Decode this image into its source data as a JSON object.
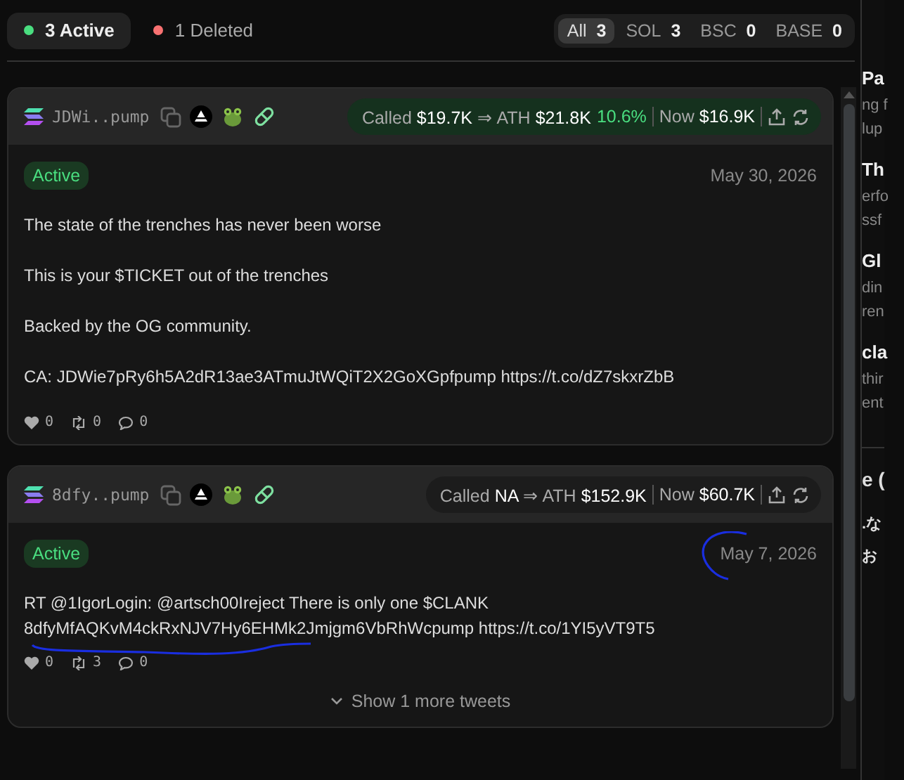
{
  "tabs": [
    {
      "label": "3 Active",
      "color": "#4ade80",
      "selected": true
    },
    {
      "label": "1 Deleted",
      "color": "#f87171",
      "selected": false
    }
  ],
  "chains": [
    {
      "label": "All",
      "count": "3",
      "selected": true
    },
    {
      "label": "SOL",
      "count": "3",
      "selected": false
    },
    {
      "label": "BSC",
      "count": "0",
      "selected": false
    },
    {
      "label": "BASE",
      "count": "0",
      "selected": false
    }
  ],
  "cards": [
    {
      "token": "JDWi..pump",
      "positive": true,
      "called_label": "Called",
      "called": "$19.7K",
      "arrow": "⇒",
      "ath_label": "ATH",
      "ath": "$21.8K",
      "gain": "10.6%",
      "now_label": "Now",
      "now": "$16.9K",
      "status": "Active",
      "date": "May 30, 2026",
      "annotated": false,
      "paragraphs": [
        "The state of the trenches has never been worse",
        "This is your $TICKET out of the trenches",
        "Backed by the OG community.",
        "CA: JDWie7pRy6h5A2dR13ae3ATmuJtWQiT2X2GoXGpfpump https://t.co/dZ7skxrZbB"
      ],
      "likes": "0",
      "retweets": "0",
      "replies": "0"
    },
    {
      "token": "8dfy..pump",
      "positive": false,
      "called_label": "Called",
      "called": "NA",
      "arrow": "⇒",
      "ath_label": "ATH",
      "ath": "$152.9K",
      "now_label": "Now",
      "now": "$60.7K",
      "status": "Active",
      "date": "May 7, 2026",
      "annotated": true,
      "paragraphs": [
        "RT @1IgorLogin: @artsch00Ireject There is only one $CLANK 8dfyMfAQKvM4ckRxNJV7Hy6EHMk2Jmjgm6VbRhWcpump https://t.co/1YI5yVT9T5"
      ],
      "likes": "0",
      "retweets": "3",
      "replies": "0",
      "more": "Show 1 more tweets"
    }
  ],
  "side_panel": [
    {
      "kind": "heading",
      "text": "Pa"
    },
    {
      "kind": "body",
      "text": "ng f"
    },
    {
      "kind": "body",
      "text": "lup"
    },
    {
      "kind": "heading",
      "text": "Th"
    },
    {
      "kind": "body",
      "text": "erfo"
    },
    {
      "kind": "body",
      "text": "ssf"
    },
    {
      "kind": "heading",
      "text": "Gl"
    },
    {
      "kind": "body",
      "text": "din"
    },
    {
      "kind": "body",
      "text": "ren"
    },
    {
      "kind": "heading",
      "text": "cla"
    },
    {
      "kind": "body",
      "text": "thir"
    },
    {
      "kind": "body",
      "text": "ent"
    },
    {
      "kind": "rule"
    },
    {
      "kind": "title",
      "text": "e ("
    },
    {
      "kind": "cjk",
      "text": ".な"
    },
    {
      "kind": "cjk",
      "text": "お"
    }
  ]
}
